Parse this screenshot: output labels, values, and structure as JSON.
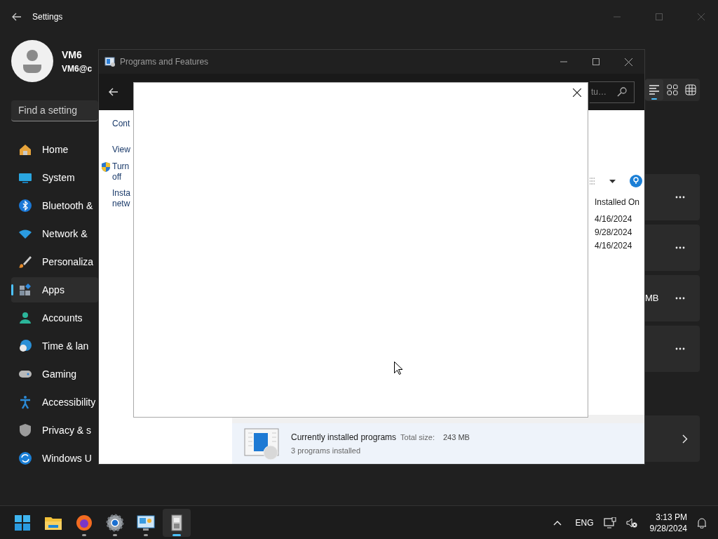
{
  "settings": {
    "title": "Settings",
    "profile": {
      "name": "VM6",
      "email": "VM6@c"
    },
    "search": {
      "placeholder": "Find a setting"
    },
    "nav": [
      {
        "kind": "home",
        "label": "Home",
        "selected": false
      },
      {
        "kind": "system",
        "label": "System",
        "selected": false
      },
      {
        "kind": "bluetooth",
        "label": "Bluetooth &",
        "selected": false
      },
      {
        "kind": "network",
        "label": "Network &",
        "selected": false
      },
      {
        "kind": "personalization",
        "label": "Personaliza",
        "selected": false
      },
      {
        "kind": "apps",
        "label": "Apps",
        "selected": true
      },
      {
        "kind": "accounts",
        "label": "Accounts",
        "selected": false
      },
      {
        "kind": "time",
        "label": "Time & lan",
        "selected": false
      },
      {
        "kind": "gaming",
        "label": "Gaming",
        "selected": false
      },
      {
        "kind": "accessibility",
        "label": "Accessibility",
        "selected": false
      },
      {
        "kind": "privacy",
        "label": "Privacy & s",
        "selected": false
      },
      {
        "kind": "update",
        "label": "Windows U",
        "selected": false
      }
    ],
    "view_modes": [
      {
        "kind": "list",
        "selected": true
      },
      {
        "kind": "tiles",
        "selected": false
      },
      {
        "kind": "grid",
        "selected": false
      }
    ],
    "app_rows": [
      {
        "kind": "menu"
      },
      {
        "kind": "menu"
      },
      {
        "kind": "menu",
        "size": "MB"
      },
      {
        "kind": "menu"
      },
      {
        "kind": "link"
      }
    ]
  },
  "programs_window": {
    "title": "Programs and Features",
    "active": false,
    "search": {
      "placeholder": "tu…"
    },
    "tasks": [
      {
        "kind": "link",
        "lines": [
          "Cont"
        ]
      },
      {
        "kind": "link",
        "lines": [
          "View"
        ]
      },
      {
        "kind": "shield",
        "lines": [
          "Turn",
          "off"
        ]
      },
      {
        "kind": "link",
        "lines": [
          "Insta",
          "netw"
        ]
      }
    ],
    "columns": [
      "Installed On"
    ],
    "rows": [
      [
        "4/16/2024"
      ],
      [
        "9/28/2024"
      ],
      [
        "4/16/2024"
      ]
    ],
    "details": {
      "title": "Currently installed programs",
      "size_label": "Total size:",
      "size": "243 MB",
      "count": "3 programs installed"
    }
  },
  "taskbar": {
    "apps": [
      {
        "kind": "start",
        "running": false,
        "selected": false
      },
      {
        "kind": "folder",
        "running": false,
        "selected": false
      },
      {
        "kind": "firefox",
        "running": true,
        "selected": false
      },
      {
        "kind": "settings",
        "running": true,
        "selected": false
      },
      {
        "kind": "control-panel",
        "running": true,
        "selected": false
      },
      {
        "kind": "installer",
        "running": true,
        "selected": true
      }
    ],
    "language": "ENG",
    "time": "3:13 PM",
    "date": "9/28/2024"
  }
}
